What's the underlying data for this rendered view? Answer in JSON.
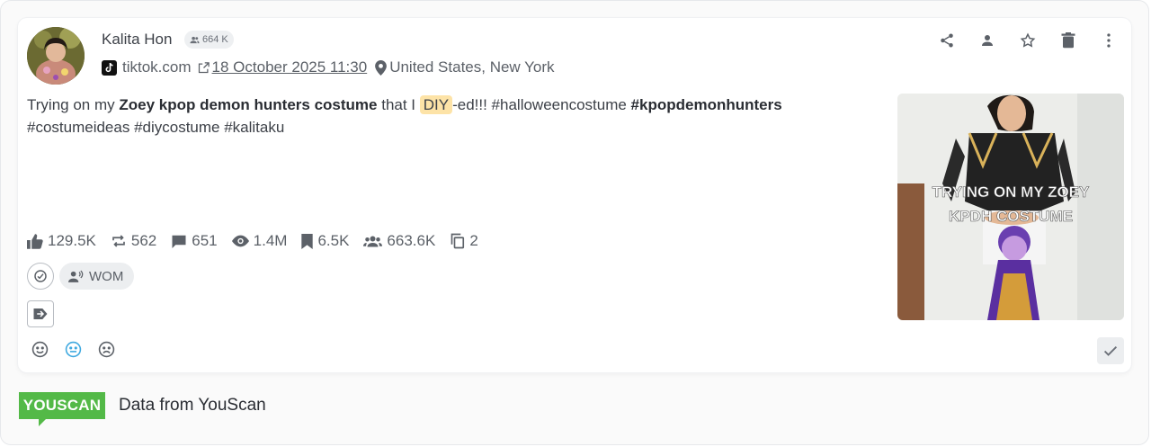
{
  "post": {
    "author": "Kalita Hon",
    "followers": "664 K",
    "source": "tiktok.com",
    "date": "18 October 2025 11:30",
    "location": "United States, New York",
    "text": {
      "p1": "Trying on my ",
      "b1": "Zoey kpop demon hunters costume",
      "p2": " that I ",
      "highlight": "DIY",
      "p3": "-ed!!! #halloweencostume ",
      "b2": "#kpopdemonhunters",
      "p4": " #costumeideas #diycostume #kalitaku"
    },
    "thumbnail_caption": [
      "TRYING ON MY ZOEY",
      "KPDH COSTUME"
    ],
    "stats": {
      "likes": "129.5K",
      "reposts": "562",
      "comments": "651",
      "views": "1.4M",
      "saves": "6.5K",
      "audience": "663.6K",
      "duplicates": "2"
    },
    "tag": "WOM"
  },
  "footer": {
    "logo": "YOUSCAN",
    "text": "Data from YouScan"
  },
  "colors": {
    "brand_green": "#53b947",
    "highlight": "#fde3a7",
    "neutral_sentiment": "#3fa9e0"
  },
  "icons": [
    "share-icon",
    "person-icon",
    "star-icon",
    "trash-icon",
    "more-vert-icon",
    "tiktok-icon",
    "external-link-icon",
    "location-pin-icon",
    "thumb-up-icon",
    "repost-icon",
    "comment-icon",
    "eye-icon",
    "bookmark-icon",
    "group-icon",
    "copy-icon",
    "check-circle-icon",
    "megaphone-icon",
    "tag-arrow-icon",
    "smile-icon",
    "neutral-face-icon",
    "sad-face-icon",
    "check-icon"
  ]
}
